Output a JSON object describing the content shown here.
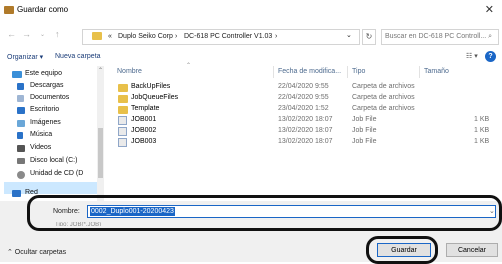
{
  "window": {
    "title": "Guardar como"
  },
  "nav": {
    "back": "←",
    "forward": "→",
    "up": "↑",
    "breadcrumb": [
      "«",
      "Duplo Seiko Corp",
      "›",
      "DC-618 PC Controller V1.03",
      "›"
    ],
    "dropdown": "⌄",
    "refresh": "↻",
    "search_placeholder": "Buscar en DC-618 PC Controll... ⌕"
  },
  "toolbar": {
    "organize": "Organizar ▾",
    "new_folder": "Nueva carpeta",
    "view": "☷ ▾",
    "help": "?"
  },
  "sidebar": {
    "items": [
      {
        "label": "Este equipo",
        "icon": "computer-icon"
      },
      {
        "label": "Descargas",
        "icon": "download-icon"
      },
      {
        "label": "Documentos",
        "icon": "documents-icon"
      },
      {
        "label": "Escritorio",
        "icon": "desktop-icon"
      },
      {
        "label": "Imágenes",
        "icon": "pictures-icon"
      },
      {
        "label": "Música",
        "icon": "music-icon"
      },
      {
        "label": "Videos",
        "icon": "videos-icon"
      },
      {
        "label": "Disco local (C:)",
        "icon": "drive-icon"
      },
      {
        "label": "Unidad de CD (D",
        "icon": "cd-drive-icon"
      },
      {
        "label": "Red",
        "icon": "network-icon"
      }
    ]
  },
  "columns": {
    "name": "Nombre",
    "date": "Fecha de modifica...",
    "type": "Tipo",
    "size": "Tamaño"
  },
  "files": [
    {
      "name": "BackUpFiles",
      "date": "22/04/2020 9:55",
      "type": "Carpeta de archivos",
      "size": "",
      "kind": "folder"
    },
    {
      "name": "JobQueueFiles",
      "date": "22/04/2020 9:55",
      "type": "Carpeta de archivos",
      "size": "",
      "kind": "folder"
    },
    {
      "name": "Template",
      "date": "23/04/2020 1:52",
      "type": "Carpeta de archivos",
      "size": "",
      "kind": "folder"
    },
    {
      "name": "JOB001",
      "date": "13/02/2020 18:07",
      "type": "Job File",
      "size": "1 KB",
      "kind": "file"
    },
    {
      "name": "JOB002",
      "date": "13/02/2020 18:07",
      "type": "Job File",
      "size": "1 KB",
      "kind": "file"
    },
    {
      "name": "JOB003",
      "date": "13/02/2020 18:07",
      "type": "Job File",
      "size": "1 KB",
      "kind": "file"
    }
  ],
  "form": {
    "name_label": "Nombre:",
    "name_value": "0002_Duplo001-20200423",
    "type_label": "Tipo: JOB(*.JOB)",
    "hide_folders": "⌃ Ocultar carpetas",
    "save": "Guardar",
    "cancel": "Cancelar"
  },
  "colors": {
    "accent": "#1a66c6",
    "folder": "#e8c04a",
    "selection": "#cce8ff"
  }
}
